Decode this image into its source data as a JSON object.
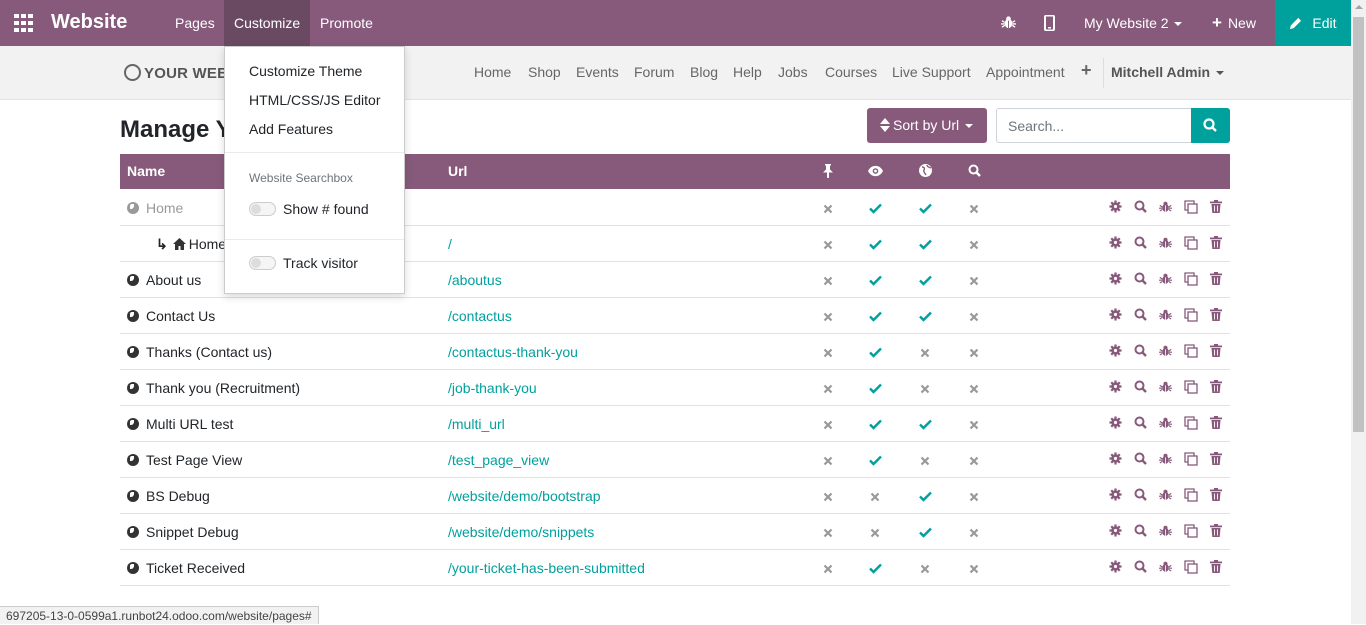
{
  "topbar": {
    "brand": "Website",
    "menus": [
      "Pages",
      "Customize",
      "Promote"
    ],
    "website_selector": "My Website 2",
    "new_label": "New",
    "edit_label": "Edit",
    "icons": [
      "apps-grid-icon",
      "bug-icon",
      "mobile-icon",
      "plus-icon",
      "pencil-icon"
    ]
  },
  "siteheader": {
    "logo": "YOUR WEB",
    "nav": [
      "Home",
      "Shop",
      "Events",
      "Forum",
      "Blog",
      "Help",
      "Jobs",
      "Courses",
      "Live Support",
      "Appointment"
    ],
    "user": "Mitchell Admin"
  },
  "page": {
    "title": "Manage Y",
    "sort_label": "Sort by Url",
    "search_placeholder": "Search..."
  },
  "dropdown": {
    "items": [
      "Customize Theme",
      "HTML/CSS/JS Editor",
      "Add Features"
    ],
    "section_header": "Website Searchbox",
    "toggle_show_found": "Show # found",
    "toggle_track_visitor": "Track visitor"
  },
  "table": {
    "headers": {
      "name": "Name",
      "url": "Url"
    },
    "header_icons": [
      "pin-icon",
      "eye-icon",
      "globe-icon",
      "search-icon"
    ],
    "action_icons": [
      "gear-icon",
      "search-icon",
      "bug-icon",
      "clone-icon",
      "trash-icon"
    ],
    "rows": [
      {
        "name": "Home",
        "url": "",
        "pin": false,
        "visible": true,
        "published": true,
        "indexed": false
      },
      {
        "name": "Home",
        "url": "/",
        "pin": false,
        "visible": true,
        "published": true,
        "indexed": false
      },
      {
        "name": "About us",
        "url": "/aboutus",
        "pin": false,
        "visible": true,
        "published": true,
        "indexed": false
      },
      {
        "name": "Contact Us",
        "url": "/contactus",
        "pin": false,
        "visible": true,
        "published": true,
        "indexed": false
      },
      {
        "name": "Thanks (Contact us)",
        "url": "/contactus-thank-you",
        "pin": false,
        "visible": true,
        "published": false,
        "indexed": false
      },
      {
        "name": "Thank you (Recruitment)",
        "url": "/job-thank-you",
        "pin": false,
        "visible": true,
        "published": false,
        "indexed": false
      },
      {
        "name": "Multi URL test",
        "url": "/multi_url",
        "pin": false,
        "visible": true,
        "published": true,
        "indexed": false
      },
      {
        "name": "Test Page View",
        "url": "/test_page_view",
        "pin": false,
        "visible": true,
        "published": false,
        "indexed": false
      },
      {
        "name": "BS Debug",
        "url": "/website/demo/bootstrap",
        "pin": false,
        "visible": false,
        "published": true,
        "indexed": false
      },
      {
        "name": "Snippet Debug",
        "url": "/website/demo/snippets",
        "pin": false,
        "visible": false,
        "published": true,
        "indexed": false
      },
      {
        "name": "Ticket Received",
        "url": "/your-ticket-has-been-submitted",
        "pin": false,
        "visible": true,
        "published": false,
        "indexed": false
      }
    ]
  },
  "statusbar": {
    "url": "697205-13-0-0599a1.runbot24.odoo.com/website/pages#"
  },
  "colors": {
    "primary": "#875a7b",
    "accent": "#00a09d",
    "muted": "#999999"
  }
}
